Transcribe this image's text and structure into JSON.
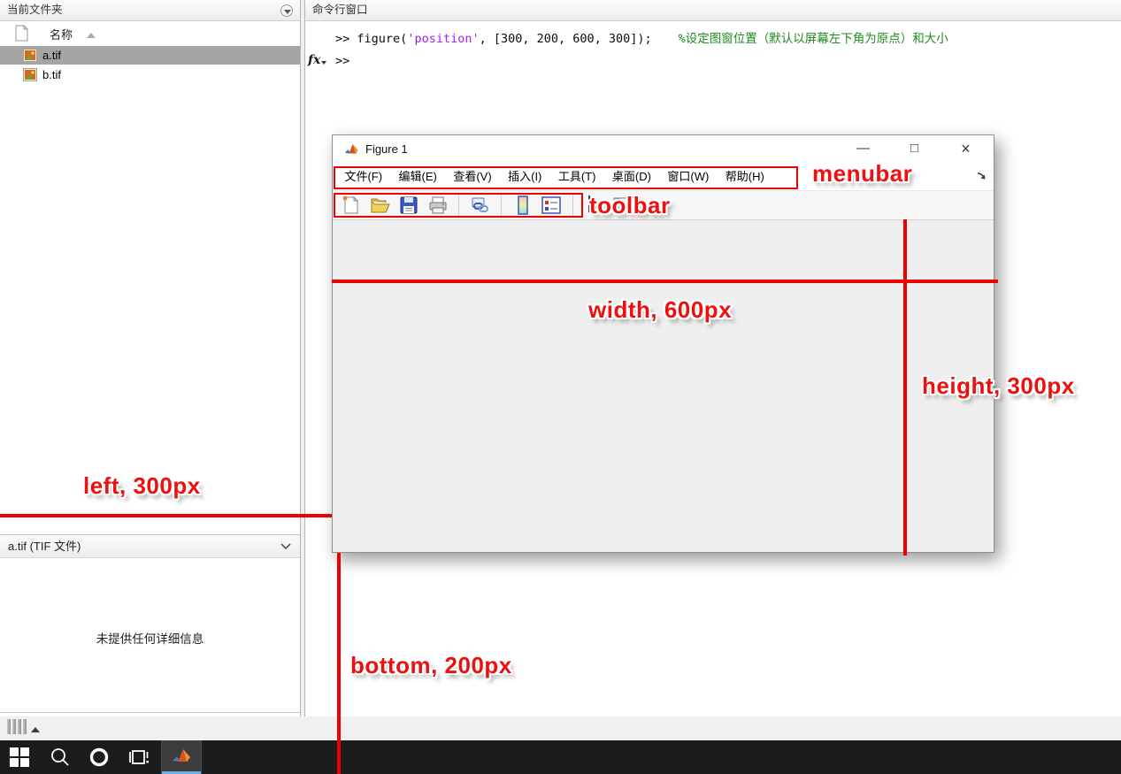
{
  "left_panel": {
    "title": "当前文件夹",
    "name_column": "名称",
    "files": [
      {
        "name": "a.tif"
      },
      {
        "name": "b.tif"
      }
    ],
    "details_header": "a.tif (TIF 文件)",
    "details_empty": "未提供任何详细信息"
  },
  "command_window": {
    "title": "命令行窗口",
    "prompt": ">>",
    "fx_label": "fx",
    "code_before_string": "figure(",
    "string_arg": "'position'",
    "code_after_string": ", [300, 200, 600, 300]);",
    "comment": "%设定图窗位置（默认以屏幕左下角为原点）和大小"
  },
  "figure_window": {
    "title": "Figure 1",
    "controls": {
      "minimize": "—",
      "maximize": "□",
      "close": "×"
    },
    "menu_items": [
      "文件(F)",
      "编辑(E)",
      "查看(V)",
      "插入(I)",
      "工具(T)",
      "桌面(D)",
      "窗口(W)",
      "帮助(H)"
    ],
    "toolbar_icon_names": [
      "new-figure",
      "open-file",
      "save-figure",
      "print-figure",
      "link-plot",
      "insert-colorbar",
      "insert-legend",
      "pointer-tool",
      "property-inspector"
    ]
  },
  "annotations": {
    "menubar": "menubar",
    "toolbar": "toolbar",
    "width": "width, 600px",
    "height": "height, 300px",
    "left": "left, 300px",
    "bottom": "bottom, 200px",
    "accent_red": "#ee0000"
  },
  "taskbar_icon_names": [
    "start",
    "search",
    "cortana",
    "task-view",
    "matlab"
  ]
}
